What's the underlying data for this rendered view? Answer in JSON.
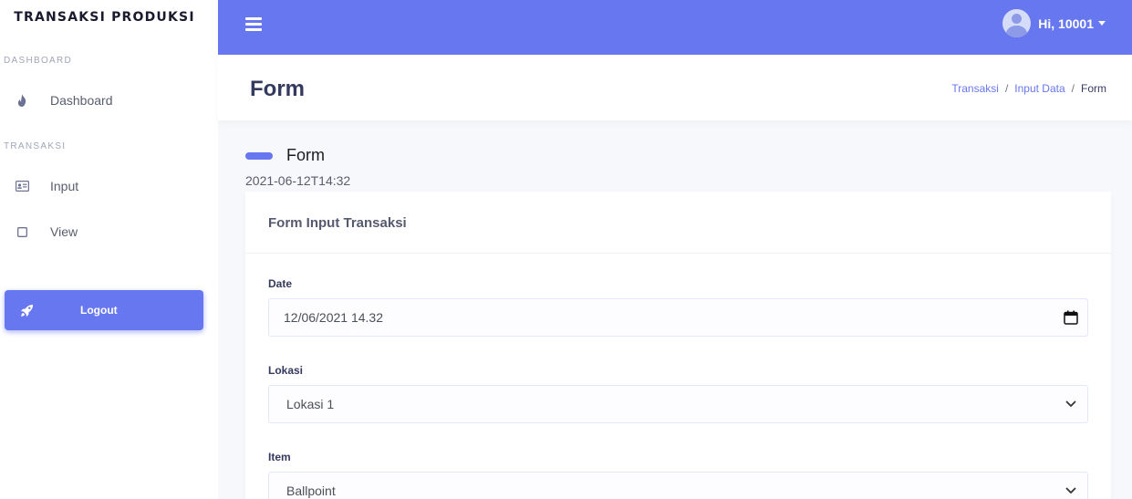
{
  "sidebar": {
    "brand": "TRANSAKSI PRODUKSI",
    "sections": [
      {
        "label": "DASHBOARD",
        "items": [
          {
            "label": "Dashboard",
            "icon": "fire-icon"
          }
        ]
      },
      {
        "label": "TRANSAKSI",
        "items": [
          {
            "label": "Input",
            "icon": "id-card-icon"
          },
          {
            "label": "View",
            "icon": "square-icon"
          }
        ]
      }
    ],
    "logout": {
      "label": "Logout",
      "icon": "rocket-icon"
    }
  },
  "topbar": {
    "menu_icon": "hamburger-icon",
    "user_greeting": "Hi, 10001",
    "avatar_icon": "user-avatar-icon"
  },
  "header": {
    "title": "Form",
    "breadcrumb": [
      "Transaksi",
      "Input Data",
      "Form"
    ],
    "breadcrumb_separator": "/"
  },
  "section": {
    "title": "Form",
    "datetime": "2021-06-12T14:32"
  },
  "card": {
    "title": "Form Input Transaksi",
    "fields": {
      "date": {
        "label": "Date",
        "value": "12/06/2021 14.32",
        "icon": "calendar-icon"
      },
      "lokasi": {
        "label": "Lokasi",
        "value": "Lokasi 1",
        "icon": "chevron-down-icon"
      },
      "item": {
        "label": "Item",
        "value": "Ballpoint",
        "icon": "chevron-down-icon"
      }
    }
  },
  "colors": {
    "primary": "#6777ef",
    "sidebar_bg": "#ffffff",
    "page_bg": "#f7f8fc"
  }
}
